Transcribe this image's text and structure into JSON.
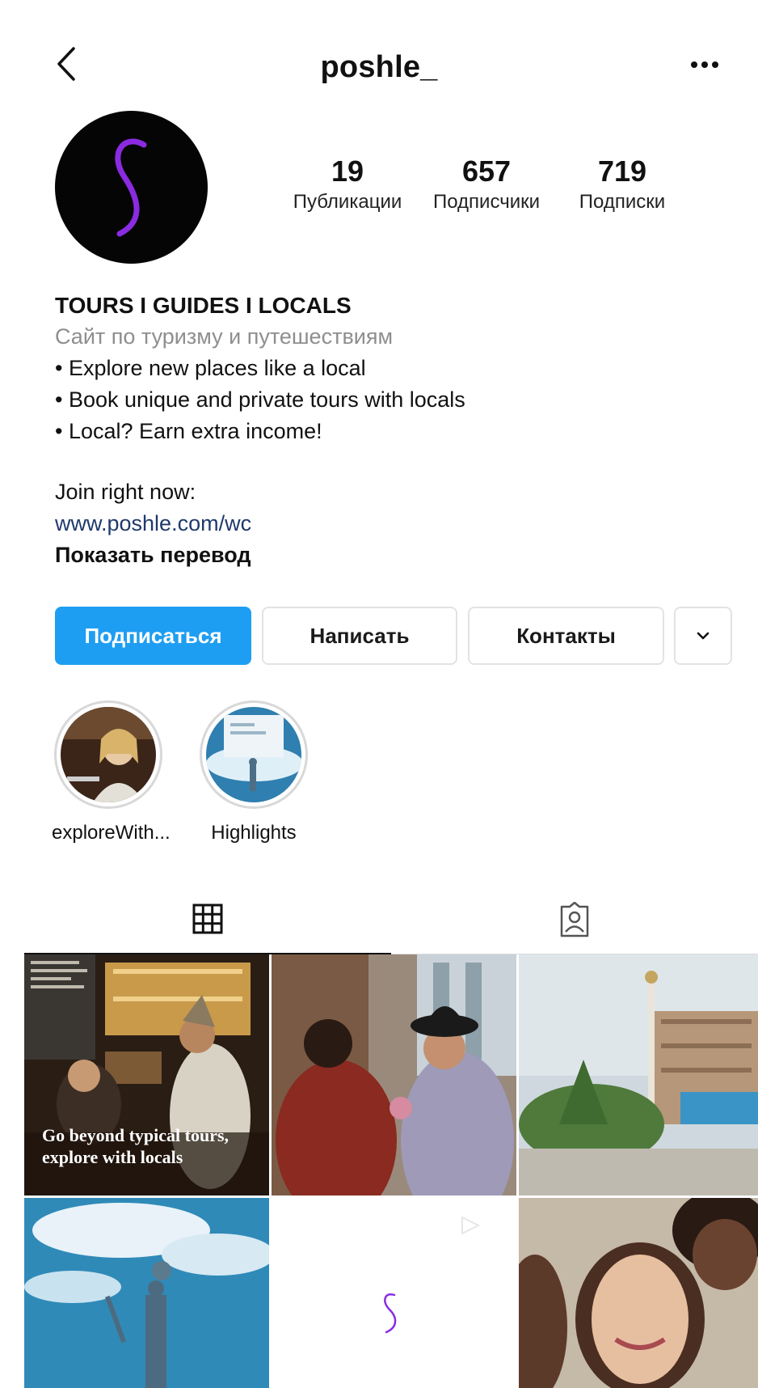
{
  "header": {
    "username": "poshle_",
    "back_icon": "chevron-left-icon",
    "more_icon": "more-horizontal-icon"
  },
  "profile": {
    "avatar_letter": "S",
    "avatar_color": "#050505",
    "avatar_accent": "#8a2be2",
    "stats": [
      {
        "value": "19",
        "label": "Публикации"
      },
      {
        "value": "657",
        "label": "Подписчики"
      },
      {
        "value": "719",
        "label": "Подписки"
      }
    ]
  },
  "bio": {
    "name": "TOURS I GUIDES I LOCALS",
    "category": "Сайт по туризму и путешествиям",
    "lines": [
      "• Explore new places like a local",
      "• Book unique and private tours with locals",
      "• Local? Earn extra income!"
    ],
    "join_text": "Join right now:",
    "link": "www.poshle.com/wc",
    "translate": "Показать перевод"
  },
  "actions": {
    "follow": "Подписаться",
    "message": "Написать",
    "contacts": "Контакты",
    "more_icon": "chevron-down-icon",
    "follow_color": "#1e9ef2"
  },
  "highlights": [
    {
      "label": "exploreWith..."
    },
    {
      "label": "Highlights"
    }
  ],
  "tabs": {
    "grid_icon": "grid-icon",
    "tagged_icon": "tagged-user-icon",
    "active": "grid"
  },
  "posts": {
    "first_caption": "Go beyond typical tours, explore with locals"
  }
}
